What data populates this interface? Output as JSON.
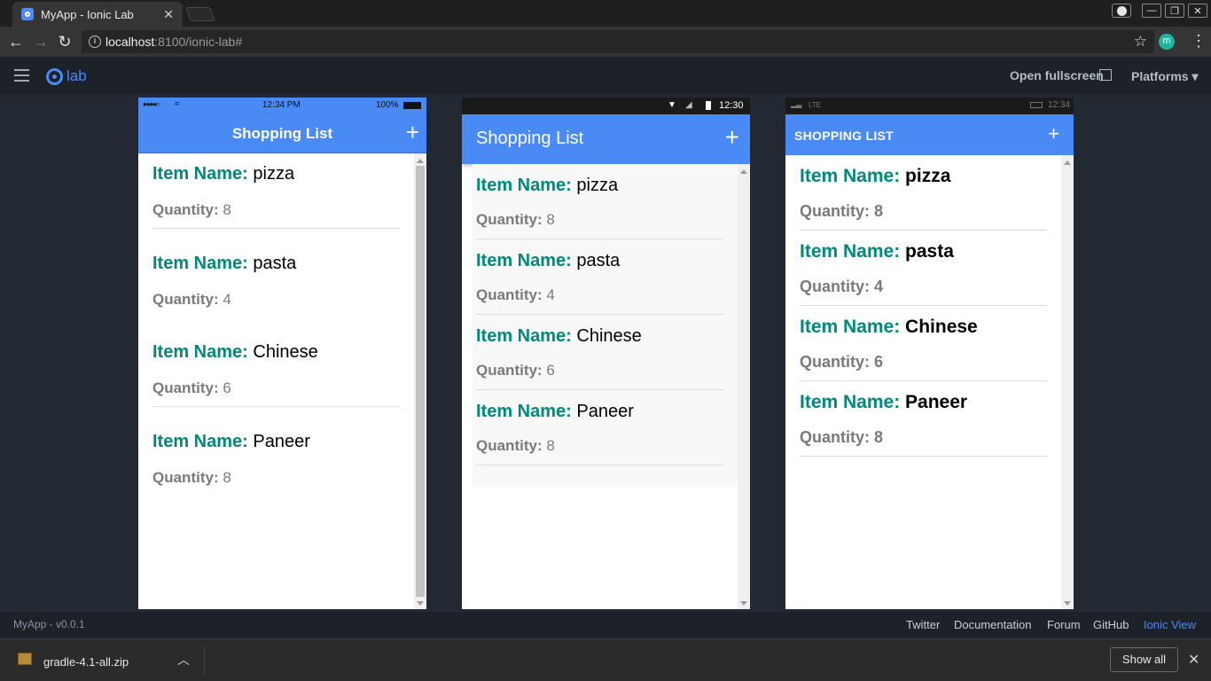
{
  "browser": {
    "tab_title": "MyApp - Ionic Lab",
    "tab_close": "✕",
    "url_host": "localhost",
    "url_rest": ":8100/ionic-lab#",
    "window_buttons": [
      "—",
      "❐",
      "✕"
    ]
  },
  "lab": {
    "logo_text": "lab",
    "open_fullscreen": "Open fullscreen",
    "platforms": "Platforms ▾"
  },
  "ios": {
    "carrier": "●●●●○",
    "time": "12:34 PM",
    "battery": "100%",
    "title": "Shopping List",
    "add": "+"
  },
  "android": {
    "time": "12:30",
    "title": "Shopping List",
    "add": "+"
  },
  "windows": {
    "network": "LTE",
    "time": "12:34",
    "title": "SHOPPING LIST",
    "add": "+"
  },
  "items": [
    {
      "name_label": "Item Name:",
      "name": "pizza",
      "qty_label": "Quantity:",
      "qty": "8"
    },
    {
      "name_label": "Item Name:",
      "name": "pasta",
      "qty_label": "Quantity:",
      "qty": "4"
    },
    {
      "name_label": "Item Name:",
      "name": "Chinese",
      "qty_label": "Quantity:",
      "qty": "6"
    },
    {
      "name_label": "Item Name:",
      "name": "Paneer",
      "qty_label": "Quantity:",
      "qty": "8"
    }
  ],
  "footer": {
    "version": "MyApp - v0.0.1",
    "links": [
      "Twitter",
      "Documentation",
      "Forum",
      "GitHub",
      "Ionic View"
    ]
  },
  "download": {
    "file": "gradle-4.1-all.zip",
    "show_all": "Show all"
  },
  "colors": {
    "ionic_primary": "#4a8af4",
    "item_label": "#00897b",
    "ionic_view_link": "#4a8af4"
  }
}
